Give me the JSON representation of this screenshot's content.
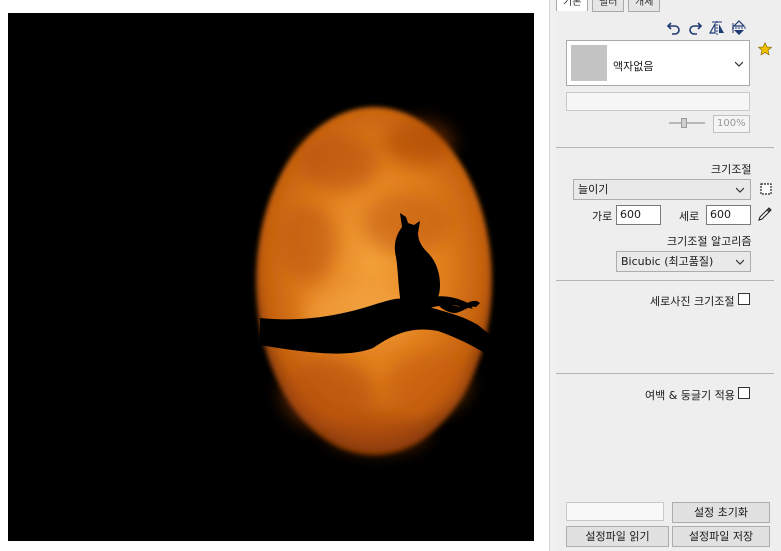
{
  "tabs": [
    {
      "label": "기본",
      "active": true
    },
    {
      "label": "필터",
      "active": false
    },
    {
      "label": "개체",
      "active": false
    }
  ],
  "toolbar": {
    "icons": [
      "rotate-left-icon",
      "rotate-right-icon",
      "flip-horizontal-icon",
      "flip-vertical-icon"
    ],
    "favorite_icon": "star-icon"
  },
  "frame": {
    "selected": "액자없음",
    "opacity_value": "100%"
  },
  "resize": {
    "section_label": "크기조절",
    "mode_selected": "늘이기",
    "width_label": "가로",
    "width_value": "600",
    "height_label": "세로",
    "height_value": "600",
    "algorithm_label": "크기조절 알고리즘",
    "algorithm_selected": "Bicubic (최고품질)",
    "portrait_label": "세로사진 크기조절"
  },
  "margin": {
    "label": "여백 & 둥글기 적용"
  },
  "buttons": {
    "reset": "설정 초기화",
    "load": "설정파일 읽기",
    "save": "설정파일 저장"
  },
  "colors": {
    "moon_core": "#f0a030",
    "moon_edge": "#c25a0a",
    "favorite": "#f2c200"
  }
}
